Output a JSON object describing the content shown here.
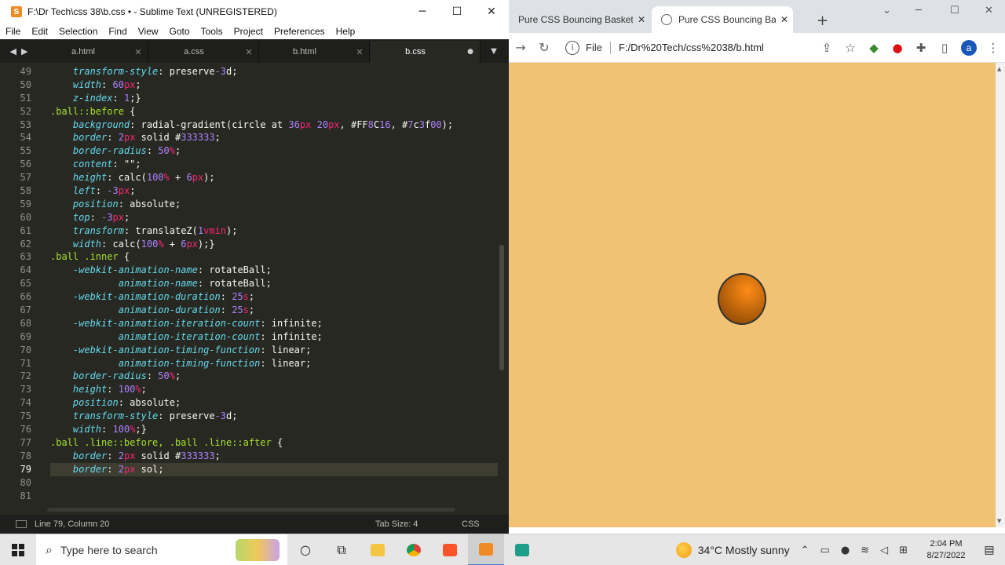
{
  "sublime": {
    "title": "F:\\Dr Tech\\css 38\\b.css • - Sublime Text (UNREGISTERED)",
    "logo": "S",
    "menu": [
      "File",
      "Edit",
      "Selection",
      "Find",
      "View",
      "Goto",
      "Tools",
      "Project",
      "Preferences",
      "Help"
    ],
    "tabs": [
      {
        "label": "a.html",
        "active": false
      },
      {
        "label": "a.css",
        "active": false
      },
      {
        "label": "b.html",
        "active": false
      },
      {
        "label": "b.css",
        "active": true,
        "modified": true
      }
    ],
    "current_line": 79,
    "code_lines": [
      {
        "n": 49,
        "text": "    transform-style: preserve-3d;"
      },
      {
        "n": 50,
        "text": "    width: 60px;"
      },
      {
        "n": 51,
        "text": "    z-index: 1;}"
      },
      {
        "n": 52,
        "text": ".ball::before {"
      },
      {
        "n": 53,
        "text": "    background: radial-gradient(circle at 36px 20px, #FF8C16, #7c3f00);"
      },
      {
        "n": 54,
        "text": "    border: 2px solid #333333;"
      },
      {
        "n": 55,
        "text": "    border-radius: 50%;"
      },
      {
        "n": 56,
        "text": "    content: \"\";"
      },
      {
        "n": 57,
        "text": "    height: calc(100% + 6px);"
      },
      {
        "n": 58,
        "text": "    left: -3px;"
      },
      {
        "n": 59,
        "text": "    position: absolute;"
      },
      {
        "n": 60,
        "text": "    top: -3px;"
      },
      {
        "n": 61,
        "text": "    transform: translateZ(1vmin);"
      },
      {
        "n": 62,
        "text": "    width: calc(100% + 6px);}"
      },
      {
        "n": 63,
        "text": ".ball .inner {"
      },
      {
        "n": 64,
        "text": "    -webkit-animation-name: rotateBall;"
      },
      {
        "n": 65,
        "text": "            animation-name: rotateBall;"
      },
      {
        "n": 66,
        "text": "    -webkit-animation-duration: 25s;"
      },
      {
        "n": 67,
        "text": "            animation-duration: 25s;"
      },
      {
        "n": 68,
        "text": "    -webkit-animation-iteration-count: infinite;"
      },
      {
        "n": 69,
        "text": "            animation-iteration-count: infinite;"
      },
      {
        "n": 70,
        "text": "    -webkit-animation-timing-function: linear;"
      },
      {
        "n": 71,
        "text": "            animation-timing-function: linear;"
      },
      {
        "n": 72,
        "text": "    border-radius: 50%;"
      },
      {
        "n": 73,
        "text": "    height: 100%;"
      },
      {
        "n": 74,
        "text": "    position: absolute;"
      },
      {
        "n": 75,
        "text": "    transform-style: preserve-3d;"
      },
      {
        "n": 76,
        "text": "    width: 100%;}"
      },
      {
        "n": 77,
        "text": ".ball .line::before, .ball .line::after {"
      },
      {
        "n": 78,
        "text": "    border: 2px solid #333333;"
      },
      {
        "n": 79,
        "text": "    border: 2px sol;"
      },
      {
        "n": 80,
        "text": ""
      },
      {
        "n": 81,
        "text": ""
      }
    ],
    "status": {
      "position": "Line 79, Column 20",
      "tab_size": "Tab Size: 4",
      "syntax": "CSS"
    }
  },
  "chrome": {
    "tabs": [
      {
        "label": "Pure CSS Bouncing Basketb",
        "active": false
      },
      {
        "label": "Pure CSS Bouncing Basketb",
        "active": true
      }
    ],
    "file_label": "File",
    "url": "F:/Dr%20Tech/css%2038/b.html",
    "avatar_letter": "a",
    "page_bg": "#f1c174"
  },
  "taskbar": {
    "search_placeholder": "Type here to search",
    "weather": "34°C  Mostly sunny",
    "time": "2:04 PM",
    "date": "8/27/2022"
  }
}
